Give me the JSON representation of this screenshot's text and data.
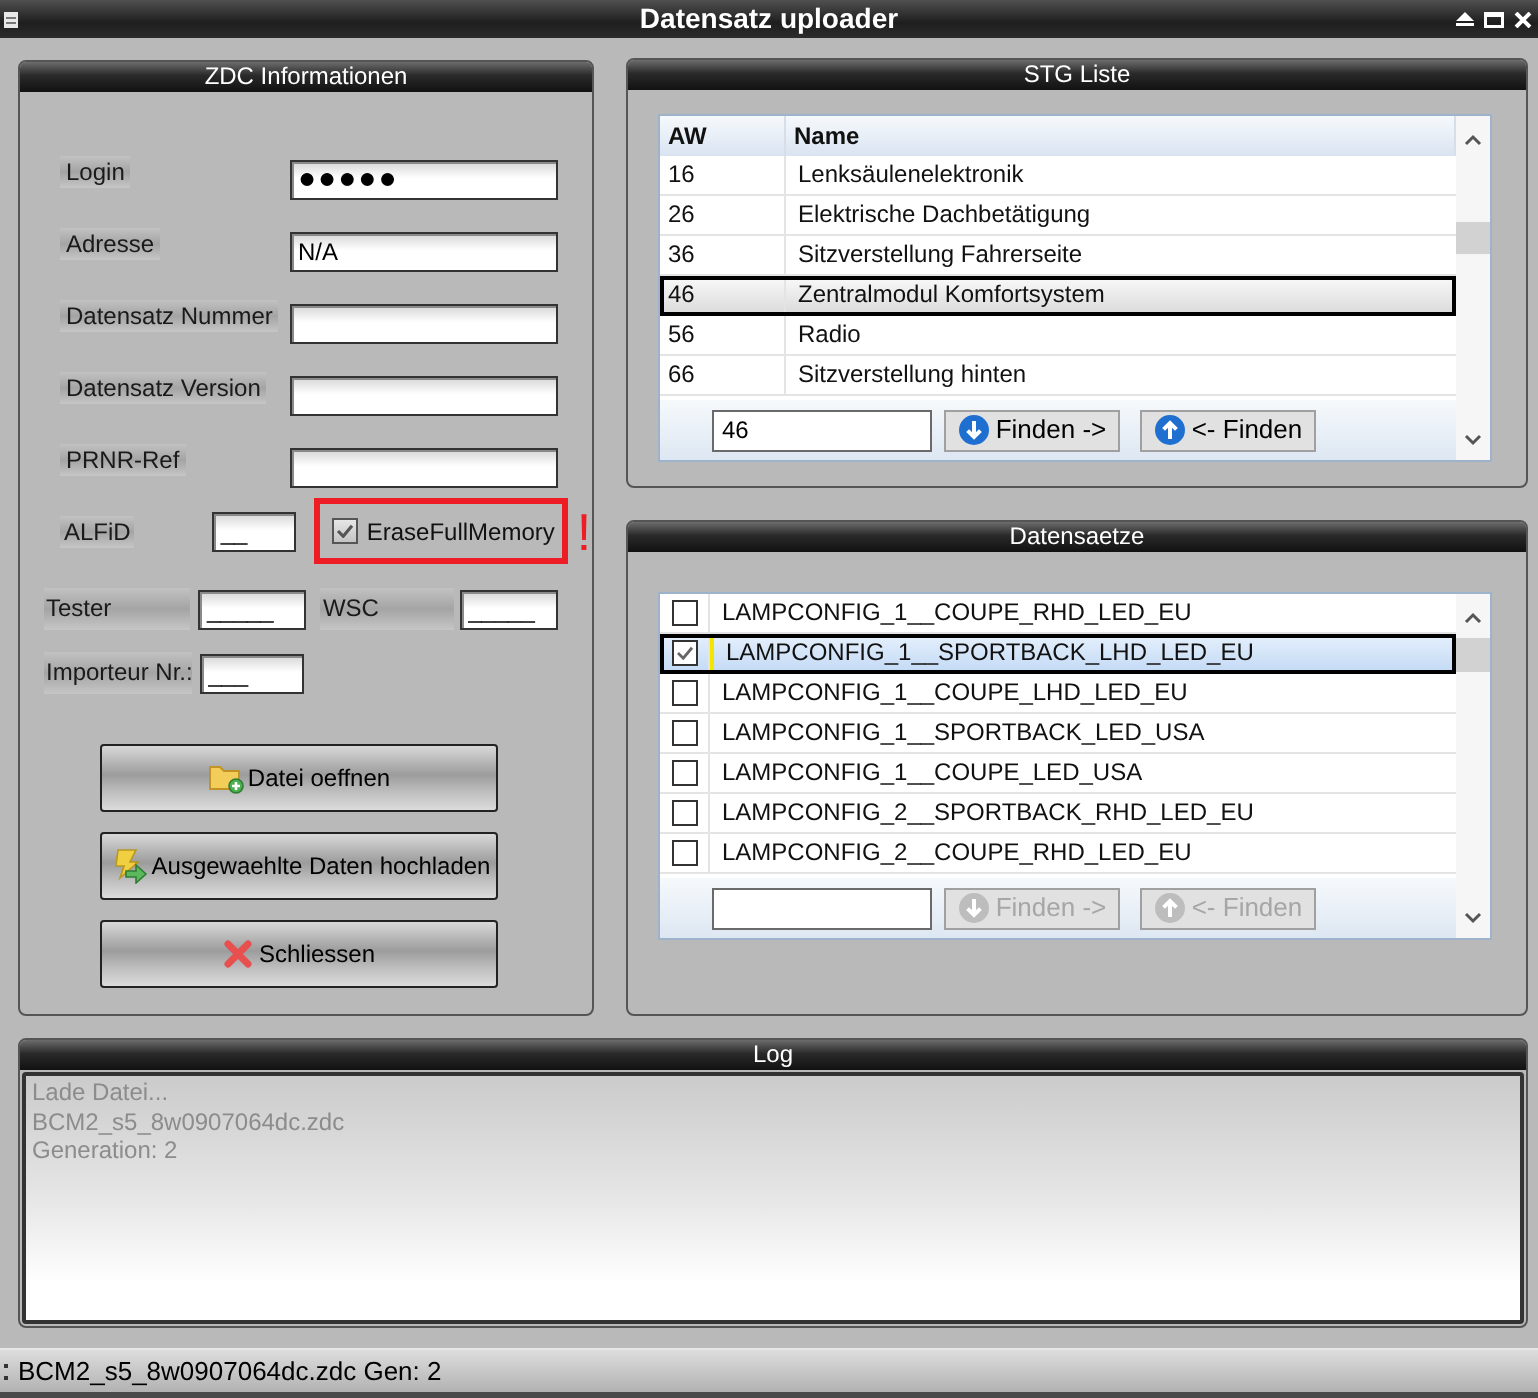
{
  "window": {
    "title": "Datensatz uploader"
  },
  "zdc_panel": {
    "title": "ZDC Informationen",
    "fields": [
      {
        "label": "Login",
        "value": "●●●●●",
        "masked": true
      },
      {
        "label": "Adresse",
        "value": "N/A",
        "masked": false
      },
      {
        "label": "Datensatz Nummer"
      },
      {
        "label": "Datensatz Version"
      },
      {
        "label": "PRNR-Ref"
      }
    ],
    "alfid": {
      "label": "ALFiD",
      "value": "__"
    },
    "erase_full_memory": {
      "label": "EraseFullMemory",
      "checked": true,
      "highlighted": true,
      "warning": "!"
    },
    "tester": {
      "label": "Tester",
      "value": "_____"
    },
    "wsc": {
      "label": "WSC",
      "value": "_____"
    },
    "importeur": {
      "label": "Importeur Nr.:",
      "value": "___"
    },
    "buttons": [
      {
        "label": "Datei oeffnen",
        "kind": "open"
      },
      {
        "label": "Ausgewaehlte Daten hochladen",
        "kind": "upload"
      },
      {
        "label": "Schliessen",
        "kind": "close"
      }
    ]
  },
  "stg_panel": {
    "title": "STG Liste",
    "columns": [
      "AW",
      "Name"
    ],
    "rows": [
      {
        "aw": "16",
        "name": "Lenksäulenelektronik",
        "selected": false
      },
      {
        "aw": "26",
        "name": "Elektrische Dachbetätigung",
        "selected": false
      },
      {
        "aw": "36",
        "name": "Sitzverstellung Fahrerseite",
        "selected": false
      },
      {
        "aw": "46",
        "name": "Zentralmodul Komfortsystem",
        "selected": true
      },
      {
        "aw": "56",
        "name": "Radio",
        "selected": false
      },
      {
        "aw": "66",
        "name": "Sitzverstellung hinten",
        "selected": false
      }
    ],
    "search": {
      "value": "46"
    },
    "buttons": [
      {
        "label": "Finden ->",
        "kind": "down",
        "disabled": false
      },
      {
        "label": "<- Finden",
        "kind": "up",
        "disabled": false
      }
    ]
  },
  "datensaetze_panel": {
    "title": "Datensaetze",
    "rows": [
      {
        "name": "LAMPCONFIG_1__COUPE_RHD_LED_EU",
        "checked": false,
        "selected": false
      },
      {
        "name": "LAMPCONFIG_1__SPORTBACK_LHD_LED_EU",
        "checked": true,
        "selected": true
      },
      {
        "name": "LAMPCONFIG_1__COUPE_LHD_LED_EU",
        "checked": false,
        "selected": false
      },
      {
        "name": "LAMPCONFIG_1__SPORTBACK_LED_USA",
        "checked": false,
        "selected": false
      },
      {
        "name": "LAMPCONFIG_1__COUPE_LED_USA",
        "checked": false,
        "selected": false
      },
      {
        "name": "LAMPCONFIG_2__SPORTBACK_RHD_LED_EU",
        "checked": false,
        "selected": false
      },
      {
        "name": "LAMPCONFIG_2__COUPE_RHD_LED_EU",
        "checked": false,
        "selected": false
      }
    ],
    "buttons": [
      {
        "label": "Finden ->",
        "kind": "down",
        "disabled": true
      },
      {
        "label": "<- Finden",
        "kind": "up",
        "disabled": true
      }
    ]
  },
  "log": {
    "title": "Log",
    "lines": [
      "Lade Datei...",
      "BCM2_s5_8w0907064dc.zdc",
      "Generation: 2"
    ]
  },
  "status_bar": {
    "text": "BCM2_s5_8w0907064dc.zdc Gen: 2"
  }
}
